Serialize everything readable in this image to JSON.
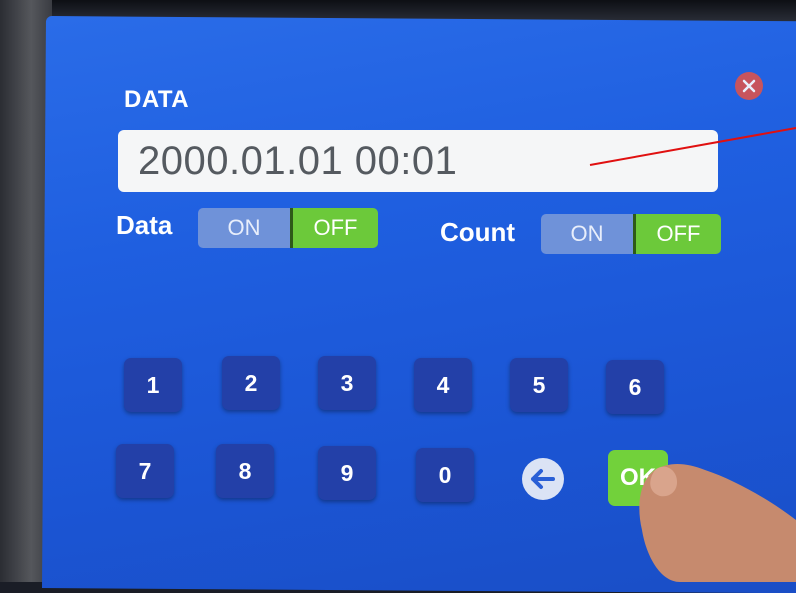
{
  "dialog": {
    "title": "DATA",
    "value": "2000.01.01 00:01"
  },
  "toggles": {
    "data": {
      "label": "Data",
      "on_label": "ON",
      "off_label": "OFF",
      "state": "OFF"
    },
    "count": {
      "label": "Count",
      "on_label": "ON",
      "off_label": "OFF",
      "state": "OFF"
    }
  },
  "keypad": {
    "row1": [
      "1",
      "2",
      "3",
      "4",
      "5",
      "6"
    ],
    "row2": [
      "7",
      "8",
      "9",
      "0"
    ],
    "ok_label": "OK"
  },
  "colors": {
    "screen_blue": "#1f5fe0",
    "key_blue": "#2340a8",
    "toggle_on_bg": "#6f92d9",
    "toggle_off_bg": "#6cc93a",
    "ok_green": "#72d13b",
    "close_red": "#d9534f"
  },
  "icons": {
    "close": "close-icon",
    "backspace": "back-arrow-icon"
  }
}
